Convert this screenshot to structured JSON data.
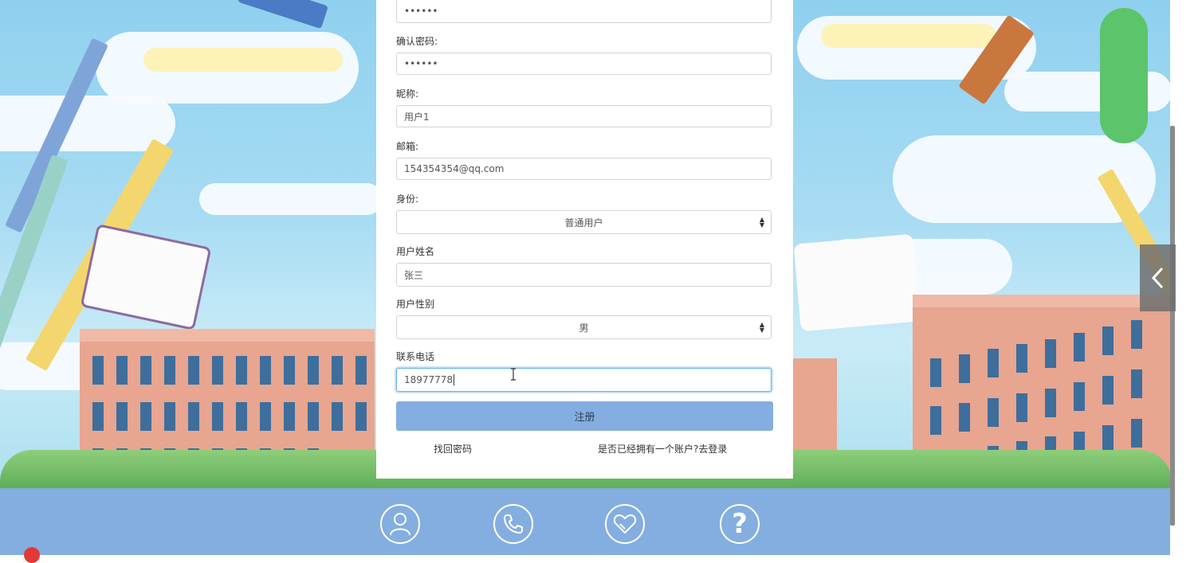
{
  "form": {
    "password_value": "••••••",
    "confirm_label": "确认密码:",
    "confirm_value": "••••••",
    "nickname_label": "昵称:",
    "nickname_value": "用户1",
    "email_label": "邮箱:",
    "email_value": "154354354@qq.com",
    "identity_label": "身份:",
    "identity_selected": "普通用户",
    "realname_label": "用户姓名",
    "realname_value": "张三",
    "gender_label": "用户性别",
    "gender_selected": "男",
    "phone_label": "联系电话",
    "phone_value": "18977778",
    "register_button": "注册",
    "forgot_link": "找回密码",
    "login_link": "是否已经拥有一个账户?去登录"
  },
  "footer": {
    "icons": [
      "user-icon",
      "phone-icon",
      "heart-icon",
      "help-icon"
    ],
    "help_glyph": "?"
  },
  "colors": {
    "accent": "#84aee0",
    "focus_border": "#66afe9"
  }
}
